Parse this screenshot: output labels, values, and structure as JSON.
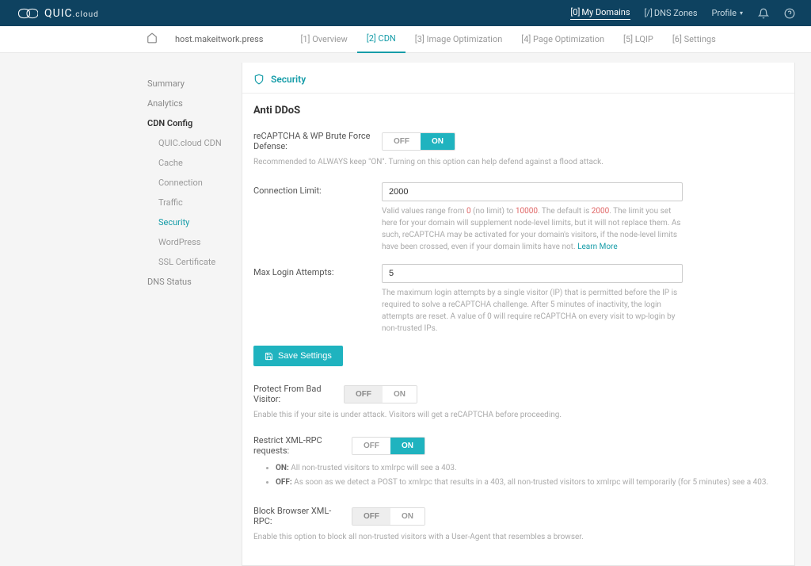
{
  "topbar": {
    "brand_main": "QUIC",
    "brand_sub": ".cloud",
    "my_domains_prefix": "[0]",
    "my_domains": "My Domains",
    "dns_zones_prefix": "[/]",
    "dns_zones": "DNS Zones",
    "profile": "Profile"
  },
  "breadcrumb": {
    "host": "host.makeitwork.press"
  },
  "tabs": {
    "overview": "[1] Overview",
    "cdn": "[2] CDN",
    "image_opt": "[3] Image Optimization",
    "page_opt": "[4] Page Optimization",
    "lqip": "[5] LQIP",
    "settings": "[6] Settings"
  },
  "sidebar": {
    "summary": "Summary",
    "analytics": "Analytics",
    "cdn_config": "CDN Config",
    "sub": {
      "quic_cdn": "QUIC.cloud CDN",
      "cache": "Cache",
      "connection": "Connection",
      "traffic": "Traffic",
      "security": "Security",
      "wordpress": "WordPress",
      "ssl": "SSL Certificate"
    },
    "dns_status": "DNS Status"
  },
  "security": {
    "title": "Security",
    "anti_ddos": "Anti DDoS",
    "recaptcha_label": "reCAPTCHA & WP Brute Force Defense:",
    "off": "OFF",
    "on": "ON",
    "recaptcha_help": "Recommended to ALWAYS keep \"ON\". Turning on this option can help defend against a flood attack.",
    "conn_limit_label": "Connection Limit:",
    "conn_limit_value": "2000",
    "conn_limit_help_1": "Valid values range from ",
    "conn_limit_red1": "0",
    "conn_limit_help_2": " (no limit) to ",
    "conn_limit_red2": "10000",
    "conn_limit_help_3": ". The default is ",
    "conn_limit_red3": "2000",
    "conn_limit_help_4": ". The limit you set here for your domain will supplement node-level limits, but it will not replace them. As such, reCAPTCHA may be activated for your domain's visitors, if the node-level limits have been crossed, even if your domain limits have not. ",
    "learn_more": "Learn More",
    "max_login_label": "Max Login Attempts:",
    "max_login_value": "5",
    "max_login_help": "The maximum login attempts by a single visitor (IP) that is permitted before the IP is required to solve a reCAPTCHA challenge. After 5 minutes of inactivity, the login attempts are reset. A value of 0 will require reCAPTCHA on every visit to wp-login by non-trusted IPs.",
    "save_settings": "Save Settings",
    "protect_bad_label": "Protect From Bad Visitor:",
    "protect_bad_help": "Enable this if your site is under attack. Visitors will get a reCAPTCHA before proceeding.",
    "restrict_xml_label": "Restrict XML-RPC requests:",
    "restrict_on_prefix": "ON:",
    "restrict_on_text": " All non-trusted visitors to xmlrpc will see a 403.",
    "restrict_off_prefix": "OFF:",
    "restrict_off_text": " As soon as we detect a POST to xmlrpc that results in a 403, all non-trusted visitors to xmlrpc will temporarily (for 5 minutes) see a 403.",
    "block_browser_label": "Block Browser XML-RPC:",
    "block_browser_help": "Enable this option to block all non-trusted visitors with a User-Agent that resembles a browser."
  }
}
